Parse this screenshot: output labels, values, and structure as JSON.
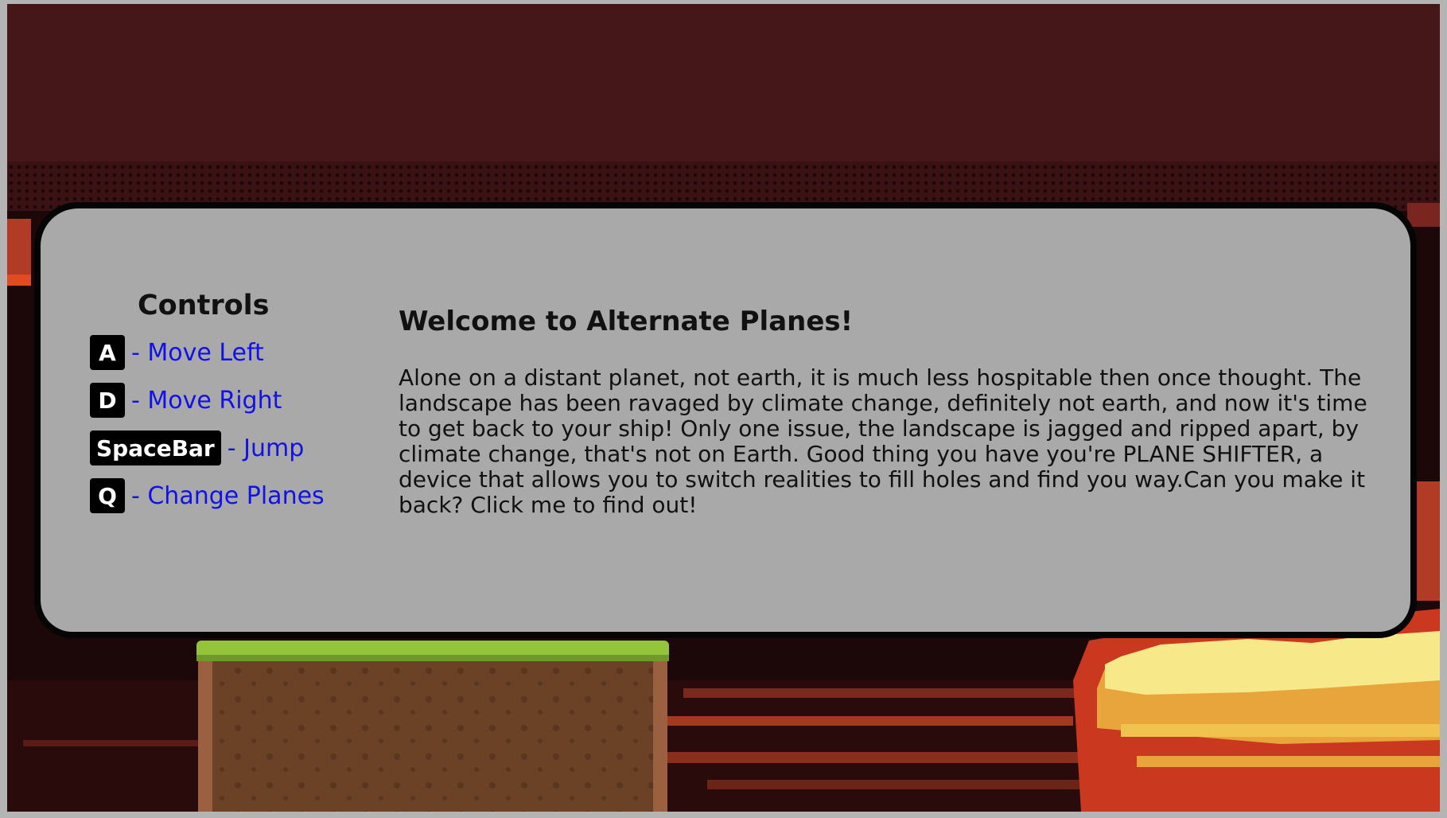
{
  "controls": {
    "title": "Controls",
    "items": [
      {
        "key": "A",
        "action": "- Move Left"
      },
      {
        "key": "D",
        "action": "- Move Right"
      },
      {
        "key": "SpaceBar",
        "action": "- Jump"
      },
      {
        "key": "Q",
        "action": "- Change Planes"
      }
    ]
  },
  "welcome": {
    "title": "Welcome to Alternate Planes!",
    "body": "Alone on a distant planet, not earth, it is much less hospitable then once thought. The landscape has been ravaged by climate change, definitely not earth, and now it's time to get back to your ship! Only one issue, the landscape is jagged and ripped apart, by climate change, that's not on Earth. Good thing you have you're PLANE SHIFTER, a device that allows you to switch realities to fill holes and find you way.Can you make it back? Click me to find out!"
  },
  "colors": {
    "sky": "#461719",
    "panel": "#a9a9a9",
    "panel_border": "#050505",
    "link_blue": "#1212e6",
    "grass": "#93c43c",
    "dirt": "#7a4b2c",
    "lava_yellow": "#f7e889",
    "lava_orange": "#e8a53c",
    "lava_red": "#c9381f"
  }
}
